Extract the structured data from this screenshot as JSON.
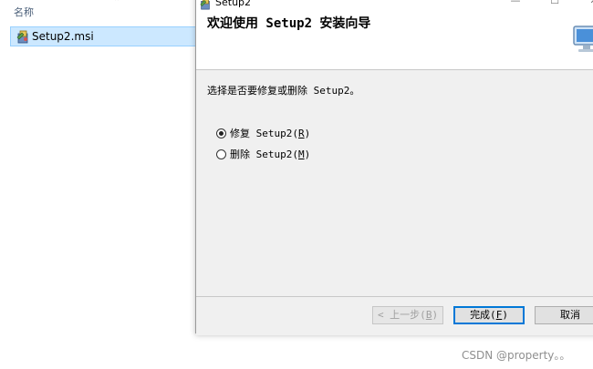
{
  "explorer": {
    "column_header": "名称",
    "file_name": "Setup2.msi"
  },
  "window": {
    "title": "Setup2",
    "heading": "欢迎使用 Setup2 安装向导",
    "instruction": "选择是否要修复或删除 Setup2。",
    "options": [
      {
        "label": "修复 Setup2(",
        "hotkey": "R",
        "suffix": ")",
        "checked": true
      },
      {
        "label": "删除 Setup2(",
        "hotkey": "M",
        "suffix": ")",
        "checked": false
      }
    ],
    "buttons": {
      "back": {
        "label": "< 上一步(",
        "hotkey": "B",
        "suffix": ")"
      },
      "finish": {
        "label": "完成(",
        "hotkey": "F",
        "suffix": ")"
      },
      "cancel": {
        "label": "取消"
      }
    }
  },
  "watermark": "CSDN @property。。",
  "colors": {
    "selection": "#cce8ff",
    "selection_border": "#99d1ff",
    "accent": "#0078d7",
    "dialog_bg": "#f0f0f0"
  },
  "icons": [
    "sort-chevron-icon",
    "msi-package-icon",
    "installer-app-icon",
    "minimize-icon",
    "maximize-icon",
    "close-icon",
    "computer-icon"
  ]
}
